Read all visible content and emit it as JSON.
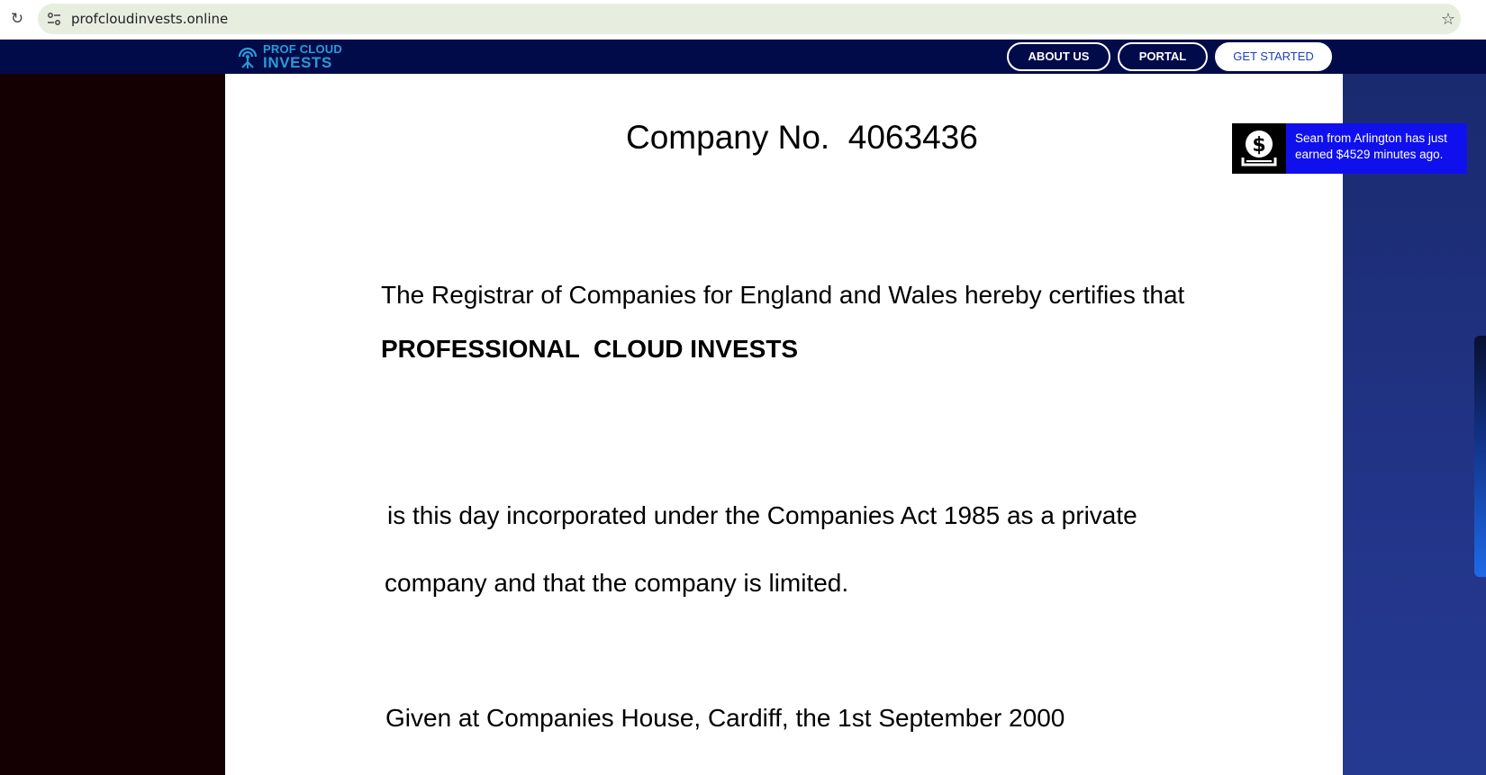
{
  "browser": {
    "url": "profcloudinvests.online",
    "reload_icon": "reload-icon",
    "site_info_icon": "site-info-icon",
    "bookmark_icon": "star-icon"
  },
  "nav": {
    "logo_line1": "PROF CLOUD",
    "logo_line2": "INVESTS",
    "logo_color": "#2a9bd6",
    "background": "#020b4a",
    "buttons": {
      "about": "ABOUT US",
      "portal": "PORTAL",
      "get_started": "GET STARTED"
    }
  },
  "certificate": {
    "company_no": "Company No.  4063436",
    "registrar": "The Registrar of Companies for England and Wales hereby certifies that",
    "company_name": "PROFESSIONAL  CLOUD INVESTS",
    "incorporated_1": "is this day incorporated under the Companies Act 1985 as a private",
    "incorporated_2": "company and that the company is limited.",
    "given": "Given at Companies House, Cardiff, the 1st September 2000"
  },
  "toast": {
    "message": "Sean from Arlington has just earned $4529 minutes ago.",
    "icon": "dollar-coin-icon",
    "background": "#1010ee"
  }
}
